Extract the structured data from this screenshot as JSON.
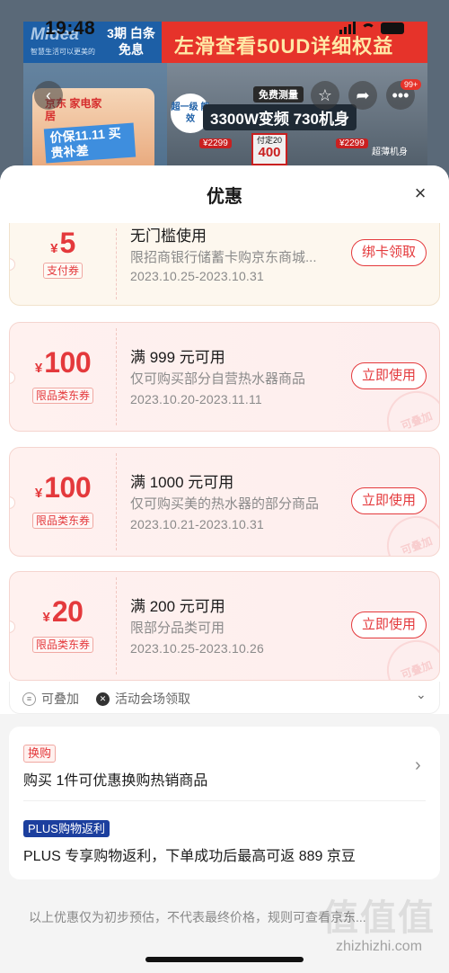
{
  "status_bar": {
    "time": "19:48"
  },
  "banner": {
    "brand": "Midea",
    "brand_sub": "智慧生活可以更美的",
    "promo_period": "3期 白条免息",
    "promo_headline": "左滑查看50UD详细权益",
    "jd_title": "京东 家电家居",
    "price_tag": "价保11.11 买贵补差",
    "grade_badge": "超一级 能效",
    "free_measure": "免费测量",
    "feature_text": "3300W变频 730机身",
    "price_chip_1": "¥2299",
    "price_chip_2": "¥2299",
    "sale_box_top": "付定20",
    "sale_box_value": "400",
    "slim_body": "超薄机身",
    "more_badge": "99+",
    "icons": [
      "back-icon",
      "star-icon",
      "share-icon",
      "more-icon"
    ]
  },
  "sheet": {
    "title": "优惠",
    "close_icon": "close-icon"
  },
  "coupons": [
    {
      "currency": "¥",
      "amount": "5",
      "kind": "支付券",
      "condition": "无门槛使用",
      "description": "限招商银行储蓄卡购京东商城...",
      "date": "2023.10.25-2023.10.31",
      "action": "绑卡领取",
      "stamp": ""
    },
    {
      "currency": "¥",
      "amount": "100",
      "kind": "限品类东券",
      "condition": "满 999 元可用",
      "description": "仅可购买部分自营热水器商品",
      "date": "2023.10.20-2023.11.11",
      "action": "立即使用",
      "stamp": "可叠加"
    },
    {
      "currency": "¥",
      "amount": "100",
      "kind": "限品类东券",
      "condition": "满 1000 元可用",
      "description": "仅可购买美的热水器的部分商品",
      "date": "2023.10.21-2023.10.31",
      "action": "立即使用",
      "stamp": "可叠加"
    },
    {
      "currency": "¥",
      "amount": "20",
      "kind": "限品类东券",
      "condition": "满 200 元可用",
      "description": "限部分品类可用",
      "date": "2023.10.25-2023.10.26",
      "action": "立即使用",
      "stamp": "可叠加"
    }
  ],
  "tags": {
    "stackable": "可叠加",
    "venue": "活动会场领取"
  },
  "extra": {
    "exchange_tag": "换购",
    "exchange_text": "购买 1件可优惠换购热销商品",
    "plus_tag": "PLUS购物返利",
    "plus_text": "PLUS 专享购物返利，下单成功后最高可返 889 京豆"
  },
  "footnote": "以上优惠仅为初步预估，不代表最终价格，规则可查看京东...",
  "watermark": {
    "glyphs": "值值值",
    "domain": "zhizhizhi.com"
  },
  "colors": {
    "accent": "#e4393c",
    "plus_blue": "#1c3f9e",
    "sheet_bg": "#f4f4f4"
  }
}
